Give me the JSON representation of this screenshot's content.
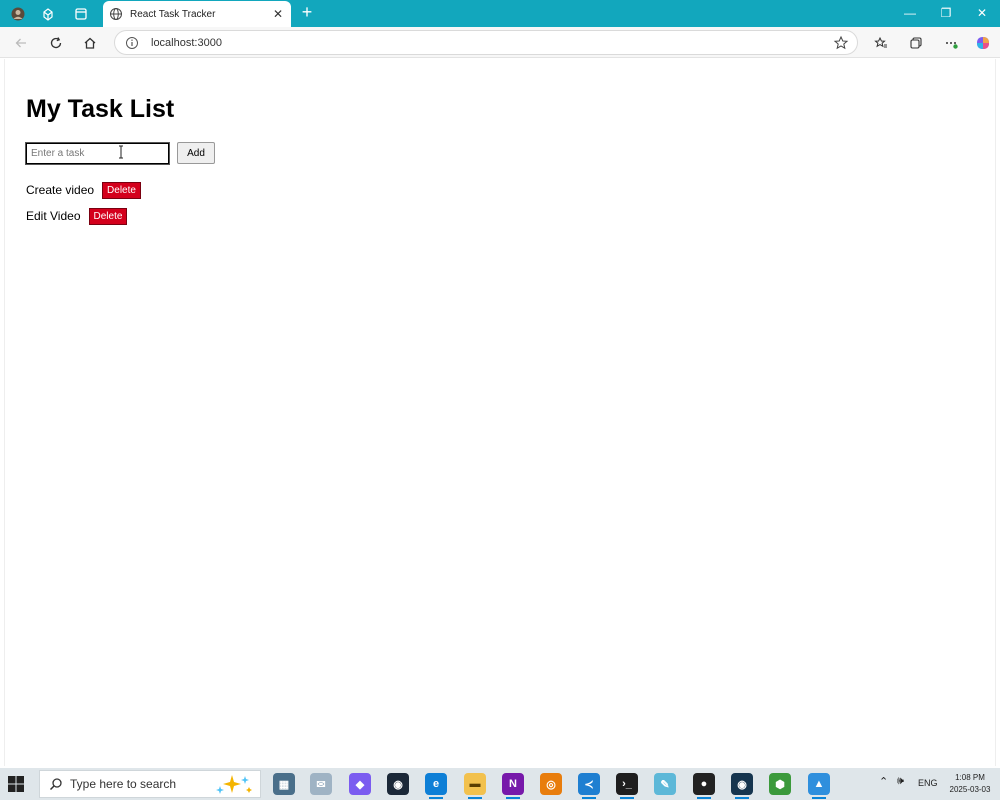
{
  "browser": {
    "tab_title": "React Task Tracker",
    "url": "localhost:3000",
    "new_tab_symbol": "+",
    "controls": {
      "minimize": "—",
      "restore": "❐",
      "close": "✕"
    }
  },
  "app": {
    "heading": "My Task List",
    "input_placeholder": "Enter a task",
    "input_value": "",
    "add_label": "Add",
    "tasks": [
      {
        "text": "Create video",
        "delete_label": "Delete"
      },
      {
        "text": "Edit Video",
        "delete_label": "Delete"
      }
    ],
    "delete_color": "#d4001c"
  },
  "taskbar": {
    "search_placeholder": "Type here to search",
    "tray": {
      "language": "ENG"
    },
    "clock": {
      "time": "1:08 PM",
      "date": "2025-03-03"
    }
  },
  "colors": {
    "titlebar": "#12a7bd",
    "taskbar": "#dfe6ea"
  }
}
